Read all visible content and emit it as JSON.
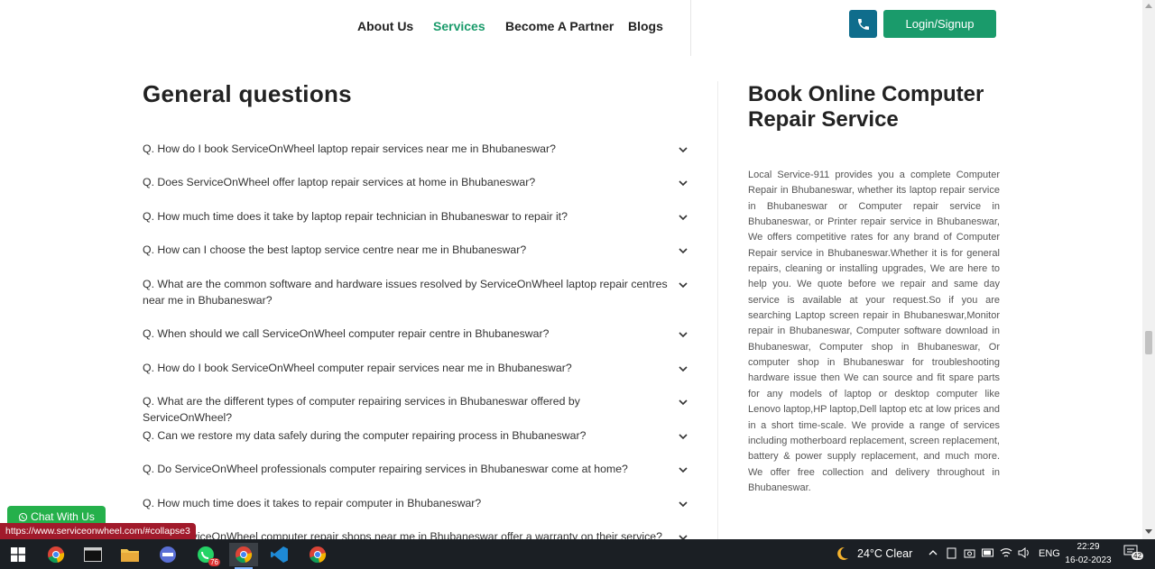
{
  "nav": {
    "items": [
      {
        "label": "About Us"
      },
      {
        "label": "Services"
      },
      {
        "label": "Become A Partner"
      },
      {
        "label": "Blogs"
      }
    ],
    "login_label": "Login/Signup",
    "phone_icon": "phone-icon"
  },
  "faq": {
    "title": "General questions",
    "items": [
      "Q. How do I book ServiceOnWheel laptop repair services near me in Bhubaneswar?",
      "Q. Does ServiceOnWheel offer laptop repair services at home in Bhubaneswar?",
      "Q. How much time does it take by laptop repair technician in Bhubaneswar to repair it?",
      "Q. How can I choose the best laptop service centre near me in Bhubaneswar?",
      "Q. What are the common software and hardware issues resolved by ServiceOnWheel laptop repair centres near me in Bhubaneswar?",
      "Q. When should we call ServiceOnWheel computer repair centre in Bhubaneswar?",
      "Q. How do I book ServiceOnWheel computer repair services near me in Bhubaneswar?",
      "Q. What are the different types of computer repairing services in Bhubaneswar offered by ServiceOnWheel?",
      "Q. Can we restore my data safely during the computer repairing process in Bhubaneswar?",
      "Q. Do ServiceOnWheel professionals computer repairing services in Bhubaneswar come at home?",
      "Q. How much time does it takes to repair computer in Bhubaneswar?",
      "Q. Do ServiceOnWheel computer repair shops near me in Bhubaneswar offer a warranty on their service?"
    ]
  },
  "book": {
    "title": "Book Online Computer Repair Service",
    "description": "Local Service-911 provides you a complete Computer Repair in Bhubaneswar, whether its laptop repair service in Bhubaneswar or Computer repair service in Bhubaneswar, or Printer repair service in Bhubaneswar, We offers competitive rates for any brand of Computer Repair service in Bhubaneswar.Whether it is for general repairs, cleaning or installing upgrades, We are here to help you. We quote before we repair and same day service is available at your request.So if you are searching Laptop screen repair in Bhubaneswar,Monitor repair in Bhubaneswar, Computer software download in Bhubaneswar, Computer shop in Bhubaneswar, Or computer shop in Bhubaneswar for troubleshooting hardware issue then We can source and fit spare parts for any models of laptop or desktop computer like Lenovo laptop,HP laptop,Dell laptop etc at low prices and in a short time-scale. We provide a range of services including motherboard replacement, screen replacement, battery & power supply replacement, and much more. We offer free collection and delivery throughout in Bhubaneswar."
  },
  "chat": {
    "label": "Chat With Us"
  },
  "status_bar": {
    "url": "https://www.serviceonwheel.com/#collapse3"
  },
  "taskbar": {
    "weather": "24°C  Clear",
    "language": "ENG",
    "time": "22:29",
    "date": "16-02-2023",
    "notification_count": "42",
    "whatsapp_badge": "76"
  },
  "colors": {
    "accent_green": "#1a9b6b",
    "phone_blue": "#0f6d8c",
    "chat_green": "#25b04b",
    "status_red": "#a11a2b"
  }
}
